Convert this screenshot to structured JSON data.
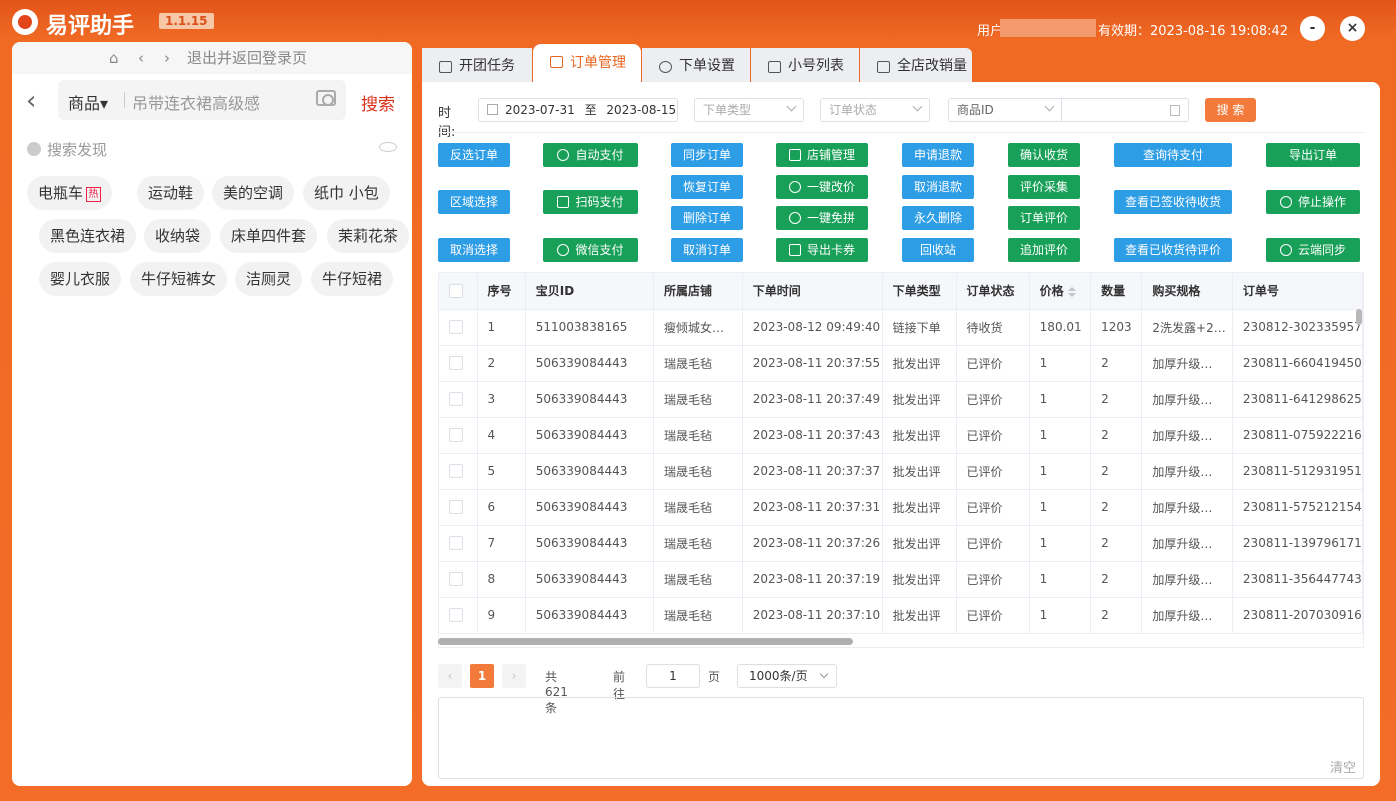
{
  "titlebar": {
    "app_name": "易评助手",
    "version": "1.1.15",
    "user_label": "用户",
    "expiry": "有效期：2023-08-16 19:08:42",
    "minimize": "-",
    "close": "×"
  },
  "left": {
    "top_nav": {
      "home": "⌂",
      "prev": "‹",
      "next": "›",
      "logout": "退出并返回登录页"
    },
    "back": "‹",
    "search_category": "商品▾",
    "search_placeholder": "吊带连衣裙高级感",
    "search_button": "搜索",
    "discover_title": "搜索发现",
    "chips": [
      "电瓶车",
      "运动鞋",
      "美的空调",
      "纸巾 小包",
      "黑色连衣裙",
      "收纳袋",
      "床单四件套",
      "茉莉花茶",
      "婴儿衣服",
      "牛仔短裤女",
      "洁厕灵",
      "牛仔短裙"
    ],
    "hot_badge": "热"
  },
  "tabs": [
    {
      "label": "开团任务"
    },
    {
      "label": "订单管理"
    },
    {
      "label": "下单设置"
    },
    {
      "label": "小号列表"
    },
    {
      "label": "全店改销量"
    }
  ],
  "filters": {
    "time_label": "时间:",
    "date_start": "2023-07-31",
    "date_sep": "至",
    "date_end": "2023-08-15",
    "order_type_placeholder": "下单类型",
    "order_status_placeholder": "订单状态",
    "field_select": "商品ID",
    "search_button": "搜 索"
  },
  "buttons": {
    "invert_select": "反选订单",
    "area_select": "区域选择",
    "cancel_select": "取消选择",
    "auto_pay": "自动支付",
    "scan_pay": "扫码支付",
    "wechat_pay": "微信支付",
    "sync_orders": "同步订单",
    "restore_orders": "恢复订单",
    "delete_orders": "删除订单",
    "cancel_orders": "取消订单",
    "store_manage": "店铺管理",
    "one_click_reprice": "一键改价",
    "one_click_free": "一键免拼",
    "export_coupons": "导出卡券",
    "request_refund": "申请退款",
    "cancel_refund": "取消退款",
    "permanent_delete": "永久删除",
    "recycle_bin": "回收站",
    "confirm_receipt": "确认收货",
    "review_collect": "评价采集",
    "order_review": "订单评价",
    "add_review": "追加评价",
    "query_pending_pay": "查询待支付",
    "view_signed_pending": "查看已签收待收货",
    "view_received_pending_review": "查看已收货待评价",
    "export_orders": "导出订单",
    "stop_operation": "停止操作",
    "cloud_sync": "云端同步"
  },
  "table": {
    "columns": [
      "",
      "序号",
      "宝贝ID",
      "所属店铺",
      "下单时间",
      "下单类型",
      "订单状态",
      "价格",
      "数量",
      "购买规格",
      "订单号"
    ],
    "rows": [
      [
        "1",
        "511003838165",
        "瘦倾城女…",
        "2023-08-12 09:49:40",
        "链接下单",
        "待收货",
        "180.01",
        "1203",
        "2洗发露+2…",
        "230812-302335957"
      ],
      [
        "2",
        "506339084443",
        "瑞晟毛毡",
        "2023-08-11 20:37:55",
        "批发出评",
        "已评价",
        "1",
        "2",
        "加厚升级…",
        "230811-660419450"
      ],
      [
        "3",
        "506339084443",
        "瑞晟毛毡",
        "2023-08-11 20:37:49",
        "批发出评",
        "已评价",
        "1",
        "2",
        "加厚升级…",
        "230811-641298625"
      ],
      [
        "4",
        "506339084443",
        "瑞晟毛毡",
        "2023-08-11 20:37:43",
        "批发出评",
        "已评价",
        "1",
        "2",
        "加厚升级…",
        "230811-075922216"
      ],
      [
        "5",
        "506339084443",
        "瑞晟毛毡",
        "2023-08-11 20:37:37",
        "批发出评",
        "已评价",
        "1",
        "2",
        "加厚升级…",
        "230811-512931951"
      ],
      [
        "6",
        "506339084443",
        "瑞晟毛毡",
        "2023-08-11 20:37:31",
        "批发出评",
        "已评价",
        "1",
        "2",
        "加厚升级…",
        "230811-575212154"
      ],
      [
        "7",
        "506339084443",
        "瑞晟毛毡",
        "2023-08-11 20:37:26",
        "批发出评",
        "已评价",
        "1",
        "2",
        "加厚升级…",
        "230811-139796171"
      ],
      [
        "8",
        "506339084443",
        "瑞晟毛毡",
        "2023-08-11 20:37:19",
        "批发出评",
        "已评价",
        "1",
        "2",
        "加厚升级…",
        "230811-356447743"
      ],
      [
        "9",
        "506339084443",
        "瑞晟毛毡",
        "2023-08-11 20:37:10",
        "批发出评",
        "已评价",
        "1",
        "2",
        "加厚升级…",
        "230811-207030916"
      ]
    ]
  },
  "pagination": {
    "prev": "‹",
    "current": "1",
    "next": "›",
    "total": "共 621 条",
    "goto_label": "前往",
    "goto_value": "1",
    "page_unit": "页",
    "page_size": "1000条/页"
  },
  "log": {
    "clear": "清空"
  },
  "colors": {
    "brand_orange": "#f27a3a",
    "blue": "#2d9de6",
    "green": "#18a058"
  }
}
